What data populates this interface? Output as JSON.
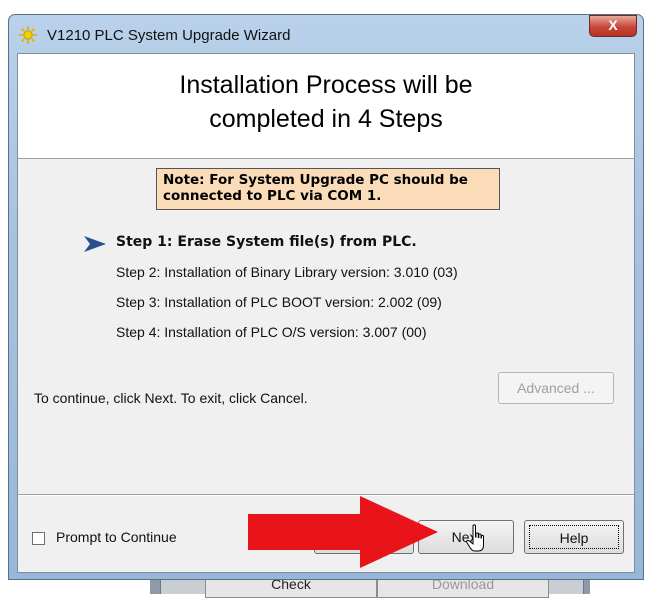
{
  "window": {
    "title": "V1210 PLC System Upgrade Wizard",
    "close_label": "X"
  },
  "header": {
    "title_line1": "Installation Process will be",
    "title_line2": "completed in 4 Steps"
  },
  "note": {
    "line1": "Note: For System Upgrade PC should be",
    "line2": "connected to PLC via COM 1."
  },
  "steps": [
    {
      "label": "Step 1: Erase System file(s) from PLC.",
      "active": true
    },
    {
      "label": "Step 2: Installation of Binary Library version: 3.010 (03)",
      "active": false
    },
    {
      "label": "Step 3: Installation of PLC BOOT version: 2.002 (09)",
      "active": false
    },
    {
      "label": "Step 4: Installation of PLC O/S version: 3.007 (00)",
      "active": false
    }
  ],
  "instruction": "To continue, click Next. To exit, click Cancel.",
  "buttons": {
    "advanced": "Advanced ...",
    "next": "Next",
    "help": "Help",
    "prompt_to_continue": "Prompt to Continue"
  },
  "background_app": {
    "check": "Check",
    "download": "Download"
  },
  "colors": {
    "note_bg": "#fbdcb9",
    "arrow": "#e8141a",
    "step_arrow": "#2a4f8f"
  }
}
